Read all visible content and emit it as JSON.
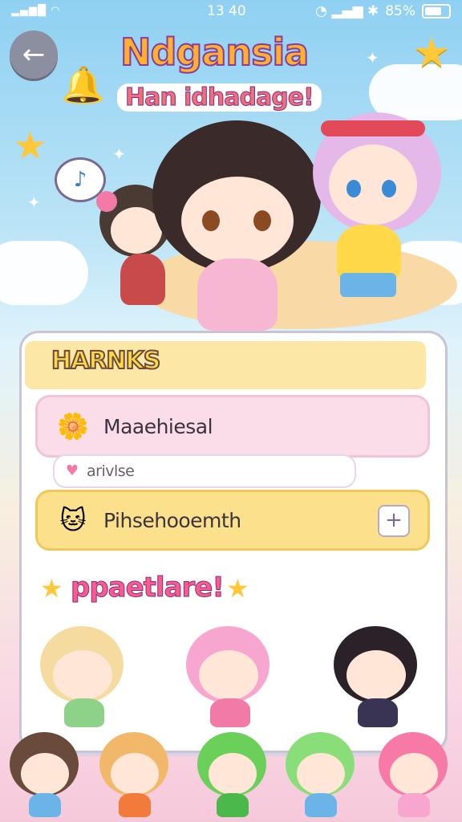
{
  "status": {
    "time": "13 40",
    "battery": "85%"
  },
  "header": {
    "title": "Ndgansia",
    "subtitle": "Han idhadage!"
  },
  "panel": {
    "title": "HARNKS",
    "rows": [
      {
        "label": "Maaehiesal",
        "icon": "flower-icon"
      },
      {
        "label": "arivlse",
        "icon": "heart-icon"
      },
      {
        "label": "Pihsehooemth",
        "icon": "cat-icon",
        "action": "+"
      }
    ]
  },
  "section": {
    "title": "ppaetlare!"
  },
  "colors": {
    "accent": "#ffb02e",
    "pink": "#ff5b8a",
    "panel_head": "#fde7a6"
  }
}
